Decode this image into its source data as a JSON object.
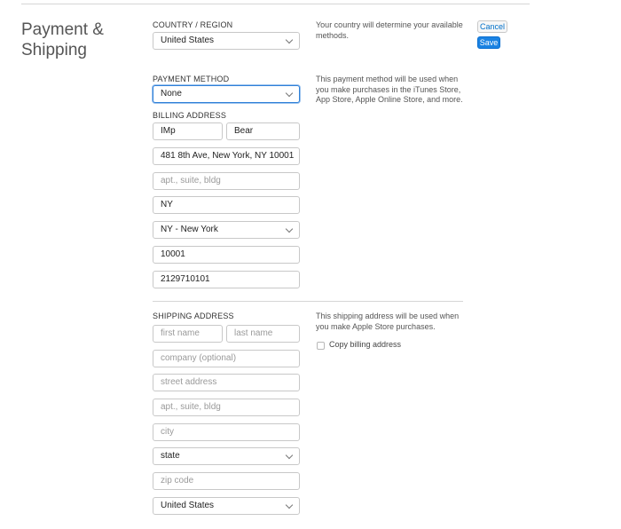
{
  "page": {
    "title": "Payment & Shipping"
  },
  "actions": {
    "cancel": "Cancel",
    "save": "Save"
  },
  "country": {
    "label": "COUNTRY / REGION",
    "value": "United States",
    "note": "Your country will determine your available methods."
  },
  "payment": {
    "label": "PAYMENT METHOD",
    "value": "None",
    "note": "This payment method will be used when you make purchases in the iTunes Store, App Store, Apple Online Store, and more."
  },
  "billing": {
    "label": "BILLING ADDRESS",
    "first_name": "IMp",
    "last_name": "Bear",
    "street": "481 8th Ave, New York, NY 10001",
    "apt_placeholder": "apt., suite, bldg",
    "city": "NY",
    "state": "NY - New York",
    "zip": "10001",
    "phone": "2129710101"
  },
  "shipping": {
    "label": "SHIPPING ADDRESS",
    "note": "This shipping address will be used when you make Apple Store purchases.",
    "copy_billing_label": "Copy billing address",
    "copy_billing_checked": false,
    "first_name_placeholder": "first name",
    "last_name_placeholder": "last name",
    "company_placeholder": "company (optional)",
    "street_placeholder": "street address",
    "apt_placeholder": "apt., suite, bldg",
    "city_placeholder": "city",
    "state_value": "state",
    "zip_placeholder": "zip code",
    "country_value": "United States"
  }
}
